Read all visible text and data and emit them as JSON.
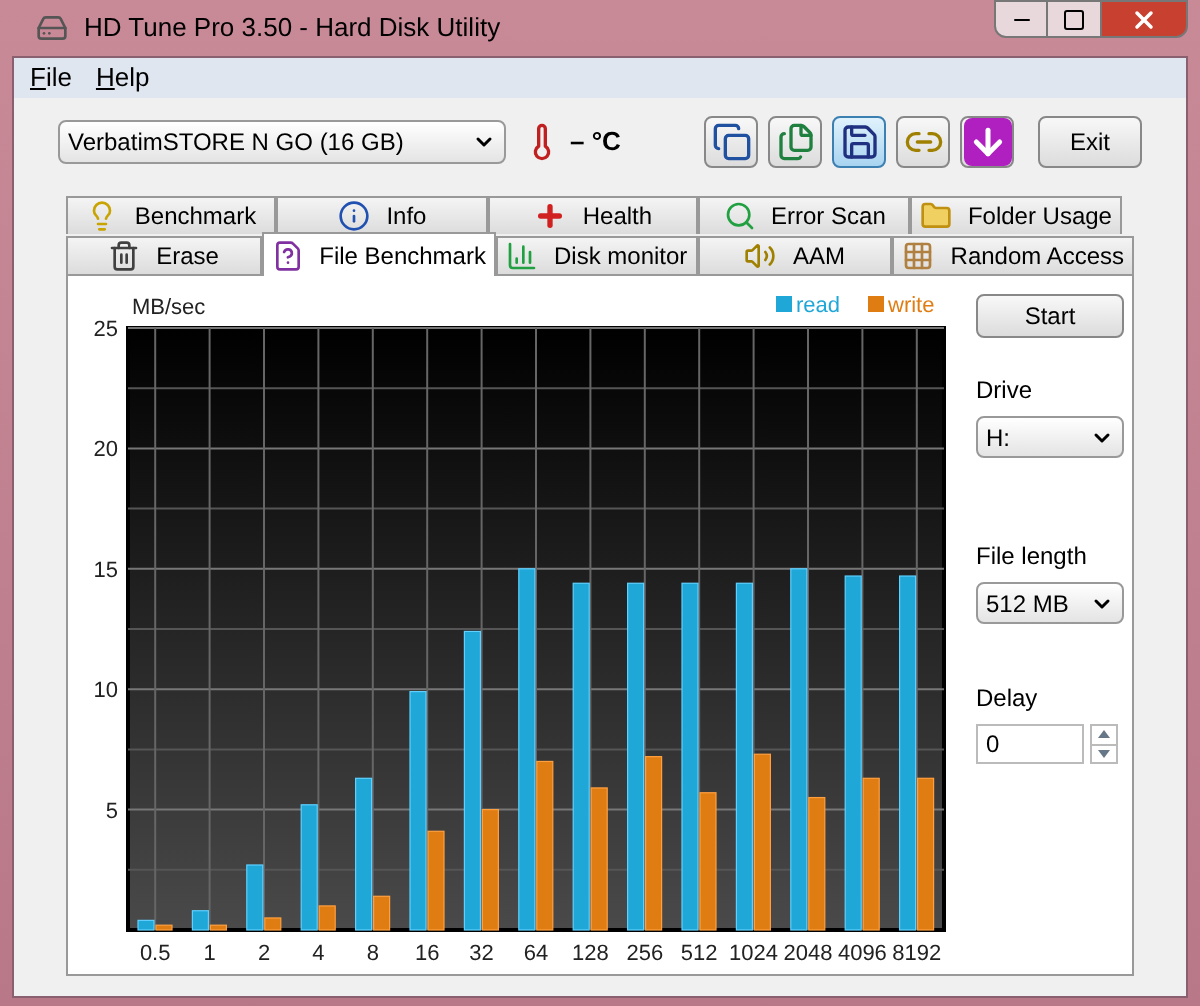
{
  "window": {
    "title": "HD Tune Pro 3.50 - Hard Disk Utility"
  },
  "menu": [
    {
      "label": "File"
    },
    {
      "label": "Help"
    }
  ],
  "toolbar": {
    "drive_select": "VerbatimSTORE N GO (16 GB)",
    "temperature": "– °C",
    "icons": [
      {
        "kind": "copy",
        "highlighted": false
      },
      {
        "kind": "copy-all",
        "highlighted": false
      },
      {
        "kind": "save",
        "highlighted": true
      },
      {
        "kind": "options",
        "highlighted": false
      },
      {
        "kind": "download",
        "highlighted": false
      }
    ],
    "exit": "Exit"
  },
  "tabs": [
    [
      {
        "label": "Benchmark",
        "kind": "bulb",
        "selected": false
      },
      {
        "label": "Info",
        "kind": "info",
        "selected": false
      },
      {
        "label": "Health",
        "kind": "cross",
        "selected": false
      },
      {
        "label": "Error Scan",
        "kind": "search",
        "selected": false
      },
      {
        "label": "Folder Usage",
        "kind": "folder",
        "selected": false
      }
    ],
    [
      {
        "label": "Erase",
        "kind": "trash",
        "selected": false
      },
      {
        "label": "File Benchmark",
        "kind": "file",
        "selected": true
      },
      {
        "label": "Disk monitor",
        "kind": "bars",
        "selected": false
      },
      {
        "label": "AAM",
        "kind": "speaker",
        "selected": false
      },
      {
        "label": "Random Access",
        "kind": "dots",
        "selected": false
      }
    ]
  ],
  "chart_data": {
    "type": "bar",
    "grid": true,
    "ylabel": "MB/sec",
    "categories": [
      "0.5",
      "1",
      "2",
      "4",
      "8",
      "16",
      "32",
      "64",
      "128",
      "256",
      "512",
      "1024",
      "2048",
      "4096",
      "8192"
    ],
    "ylim": [
      0,
      25
    ],
    "yticks": [
      5,
      10,
      15,
      20,
      25
    ],
    "series": [
      {
        "name": "read",
        "color": "#1fa7d8",
        "values": [
          0.4,
          0.8,
          2.7,
          5.2,
          6.3,
          9.9,
          12.4,
          15.0,
          14.4,
          14.4,
          14.4,
          14.4,
          15.0,
          14.7,
          14.7
        ]
      },
      {
        "name": "write",
        "color": "#e07d12",
        "values": [
          0.2,
          0.2,
          0.5,
          1.0,
          1.4,
          4.1,
          5.0,
          7.0,
          5.9,
          7.2,
          5.7,
          7.3,
          5.5,
          6.3,
          6.3
        ]
      }
    ]
  },
  "side": {
    "start": "Start",
    "drive_label": "Drive",
    "drive_value": "H:",
    "length_label": "File length",
    "length_value": "512 MB",
    "delay_label": "Delay",
    "delay_value": "0"
  }
}
